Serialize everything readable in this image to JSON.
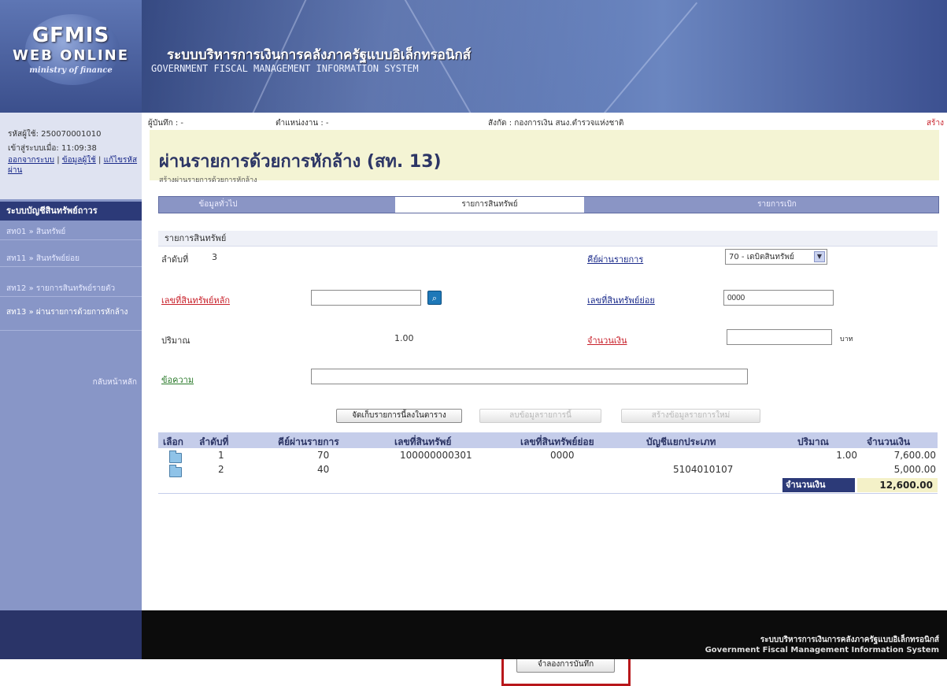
{
  "header": {
    "logo_line1": "GFMIS",
    "logo_line2": "WEB ONLINE",
    "logo_line3": "ministry of finance",
    "system_th": "ระบบบริหารการเงินการคลังภาครัฐแบบอิเล็กทรอนิกส์",
    "system_en": "GOVERNMENT FISCAL MANAGEMENT INFORMATION SYSTEM"
  },
  "sidebar": {
    "user": "รหัสผู้ใช้: 250070001010",
    "login_time": "เข้าสู่ระบบเมื่อ: 11:09:38",
    "links": [
      "ออกจากระบบ",
      "ข้อมูลผู้ใช้",
      "แก้ไขรหัสผ่าน"
    ],
    "section_title": "ระบบบัญชีสินทรัพย์ถาวร",
    "items": [
      {
        "label": "สท01 » สินทรัพย์"
      },
      {
        "label": "สท11 » สินทรัพย์ย่อย"
      },
      {
        "label": "สท12 » รายการสินทรัพย์รายตัว"
      },
      {
        "label": "สท13 » ผ่านรายการด้วยการหักล้าง"
      }
    ],
    "back_label": "กลับหน้าหลัก"
  },
  "info_bar": {
    "recorder": "ผู้บันทึก : -",
    "unit": "ตำแหน่งงาน : -",
    "agency": "สังกัด : กองการเงิน สนง.ตำรวจแห่งชาติ",
    "mode": "สร้าง"
  },
  "page": {
    "title": "ผ่านรายการด้วยการหักล้าง (สท. 13)",
    "subtitle": "สร้างผ่านรายการด้วยการหักล้าง"
  },
  "tabs": [
    {
      "label": "ข้อมูลทั่วไป"
    },
    {
      "label": "รายการสินทรัพย์"
    },
    {
      "label": "รายการเบิก"
    }
  ],
  "form": {
    "section_title": "รายการสินทรัพย์",
    "seq_label": "ลำดับที่",
    "seq_value": "3",
    "posting_key_label": "คีย์ผ่านรายการ",
    "posting_key_value": "70 - เดบิตสินทรัพย์",
    "asset_main_label": "เลขที่สินทรัพย์หลัก",
    "asset_main_value": "",
    "asset_sub_label": "เลขที่สินทรัพย์ย่อย",
    "asset_sub_value": "0000",
    "qty_label": "ปริมาณ",
    "qty_value": "1.00",
    "amount_label": "จำนวนเงิน",
    "amount_value": "",
    "amount_unit": "บาท",
    "text_label": "ข้อความ",
    "text_value": ""
  },
  "actions": {
    "store": "จัดเก็บรายการนี้ลงในตาราง",
    "delete": "ลบข้อมูลรายการนี้",
    "new": "สร้างข้อมูลรายการใหม่",
    "simulate": "จำลองการบันทึก"
  },
  "table": {
    "headers": [
      "เลือก",
      "ลำดับที่",
      "คีย์ผ่านรายการ",
      "เลขที่สินทรัพย์",
      "เลขที่สินทรัพย์ย่อย",
      "บัญชีแยกประเภท",
      "ปริมาณ",
      "จำนวนเงิน"
    ],
    "rows": [
      {
        "seq": "1",
        "key": "70",
        "asset": "100000000301",
        "sub": "0000",
        "gl": "",
        "qty": "1.00",
        "amount": "7,600.00"
      },
      {
        "seq": "2",
        "key": "40",
        "asset": "",
        "sub": "",
        "gl": "5104010107",
        "qty": "",
        "amount": "5,000.00"
      }
    ],
    "total_label": "จำนวนเงิน",
    "total_value": "12,600.00"
  },
  "footer": {
    "line1": "ระบบบริหารการเงินการคลังภาครัฐแบบอิเล็กทรอนิกส์",
    "line2": "Government Fiscal Management Information System"
  },
  "colors": {
    "accent": "#2c3a78",
    "highlight": "#b8171b",
    "required": "#c8202a"
  }
}
